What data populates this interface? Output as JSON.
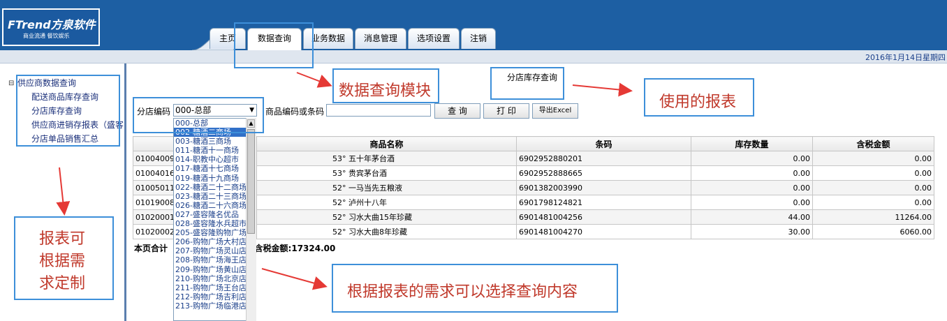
{
  "header": {
    "logo_text": "FTrend方泉软件",
    "logo_sub": "商业流通  餐饮娱乐",
    "tabs": [
      {
        "label": "主页"
      },
      {
        "label": "数据查询"
      },
      {
        "label": "业务数据"
      },
      {
        "label": "消息管理"
      },
      {
        "label": "选项设置"
      },
      {
        "label": "注销"
      }
    ],
    "date": "2016年1月14日星期四"
  },
  "sidebar": {
    "root": "供应商数据查询",
    "items": [
      "配送商品库存查询",
      "分店库存查询",
      "供应商进销存报表（盛客",
      "分店单品销售汇总"
    ]
  },
  "report_title": "分店库存查询",
  "form": {
    "store_label": "分店编码",
    "store_value": "000-总部",
    "barcode_label": "商品编码或条码",
    "barcode_value": "",
    "query_button": "查 询",
    "print_button": "打 印",
    "excel_button": "导出Excel"
  },
  "dropdown": {
    "options": [
      "000-总部",
      "002-糖酒二商场",
      "003-糖酒三商场",
      "011-糖酒十一商场",
      "014-职教中心超市",
      "017-糖酒十七商场",
      "019-糖酒十九商场",
      "022-糖酒二十二商场",
      "023-糖酒二十三商场",
      "026-糖酒二十六商场",
      "027-盛容隆名优品",
      "028-盛容隆水兵超市",
      "205-盛容隆购物广场",
      "206-购物广场大村店",
      "207-购物广场灵山店",
      "208-购物广场海王店",
      "209-购物广场黄山店",
      "210-购物广场北京店",
      "211-购物广场王台店",
      "212-购物广场吉利店",
      "213-购物广场临港店"
    ],
    "selected_index": 1
  },
  "table": {
    "headers": [
      "",
      "商品名称",
      "条码",
      "库存数量",
      "含税金额"
    ],
    "rows": [
      [
        "01004009",
        "53° 五十年茅台酒",
        "6902952880201",
        "0.00",
        "0.00"
      ],
      [
        "01004016",
        "53° 贵宾茅台酒",
        "6902952888665",
        "0.00",
        "0.00"
      ],
      [
        "01005011",
        "52° 一马当先五粮液",
        "6901382003990",
        "0.00",
        "0.00"
      ],
      [
        "01019008",
        "52° 泸州十八年",
        "6901798124821",
        "0.00",
        "0.00"
      ],
      [
        "01020001",
        "52° 习水大曲15年珍藏",
        "6901481004256",
        "44.00",
        "11264.00"
      ],
      [
        "01020002",
        "52° 习水大曲8年珍藏",
        "6901481004270",
        "30.00",
        "6060.00"
      ]
    ]
  },
  "summary": {
    "prefix": "本页合计",
    "suffix": "0  含税金额:17324.00"
  },
  "annotations": {
    "module": "数据查询模块",
    "report": "使用的报表",
    "custom": [
      "报表可",
      "根据需",
      "求定制"
    ],
    "select": "根据报表的需求可以选择查询内容"
  },
  "colors": {
    "header_bg": "#1d5fa3",
    "annotation_border": "#3d8fd9",
    "annotation_text": "#c0392b",
    "arrow": "#e53935"
  }
}
